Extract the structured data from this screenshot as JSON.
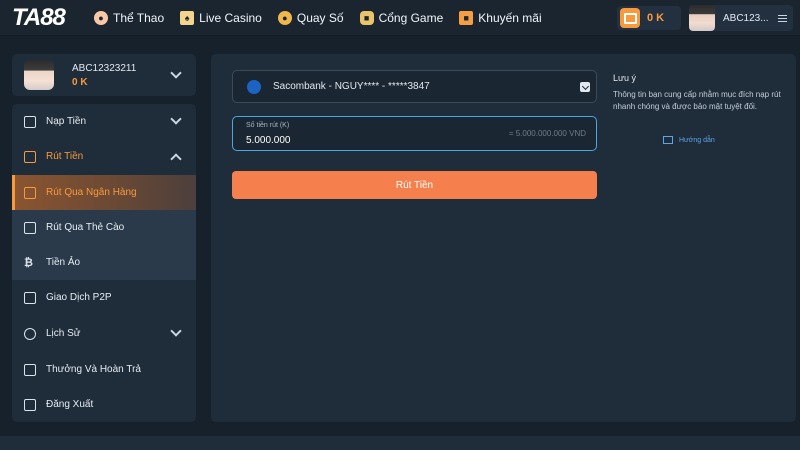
{
  "header": {
    "logo": "TA88",
    "nav": [
      {
        "label": "Thể Thao",
        "icon": "football-icon"
      },
      {
        "label": "Live Casino",
        "icon": "cards-icon"
      },
      {
        "label": "Quay Số",
        "icon": "lottery-icon"
      },
      {
        "label": "Cổng Game",
        "icon": "gamepad-icon"
      },
      {
        "label": "Khuyến mãi",
        "icon": "gift-icon"
      }
    ],
    "wallet_amount": "0 K",
    "username": "ABC123...",
    "accent": "#f79a3e"
  },
  "profile": {
    "name": "ABC12323211",
    "balance": "0 K"
  },
  "sidebar": {
    "items": [
      {
        "label": "Nạp Tiền"
      },
      {
        "label": "Rút Tiền"
      },
      {
        "label": "Rút Qua Ngân Hàng"
      },
      {
        "label": "Rút Qua Thẻ Cào"
      },
      {
        "label": "Tiền Ảo"
      },
      {
        "label": "Giao Dịch P2P"
      },
      {
        "label": "Lịch Sử"
      },
      {
        "label": "Thưởng Và Hoàn Trả"
      },
      {
        "label": "Đăng Xuất"
      }
    ]
  },
  "withdraw": {
    "bank_account": "Sacombank - NGUY**** - *****3847",
    "amount_label": "Số tiền rút (K)",
    "amount_value": "5.000.000",
    "amount_hint": "= 5.000.000.000 VND",
    "submit_label": "Rút Tiền",
    "button_color": "#f5804d"
  },
  "note": {
    "title": "Lưu ý",
    "text": "Thông tin bạn cung cấp nhằm mục đích nạp rút nhanh chóng và được bảo mật tuyệt đối.",
    "guide_label": "Hướng dẫn"
  }
}
